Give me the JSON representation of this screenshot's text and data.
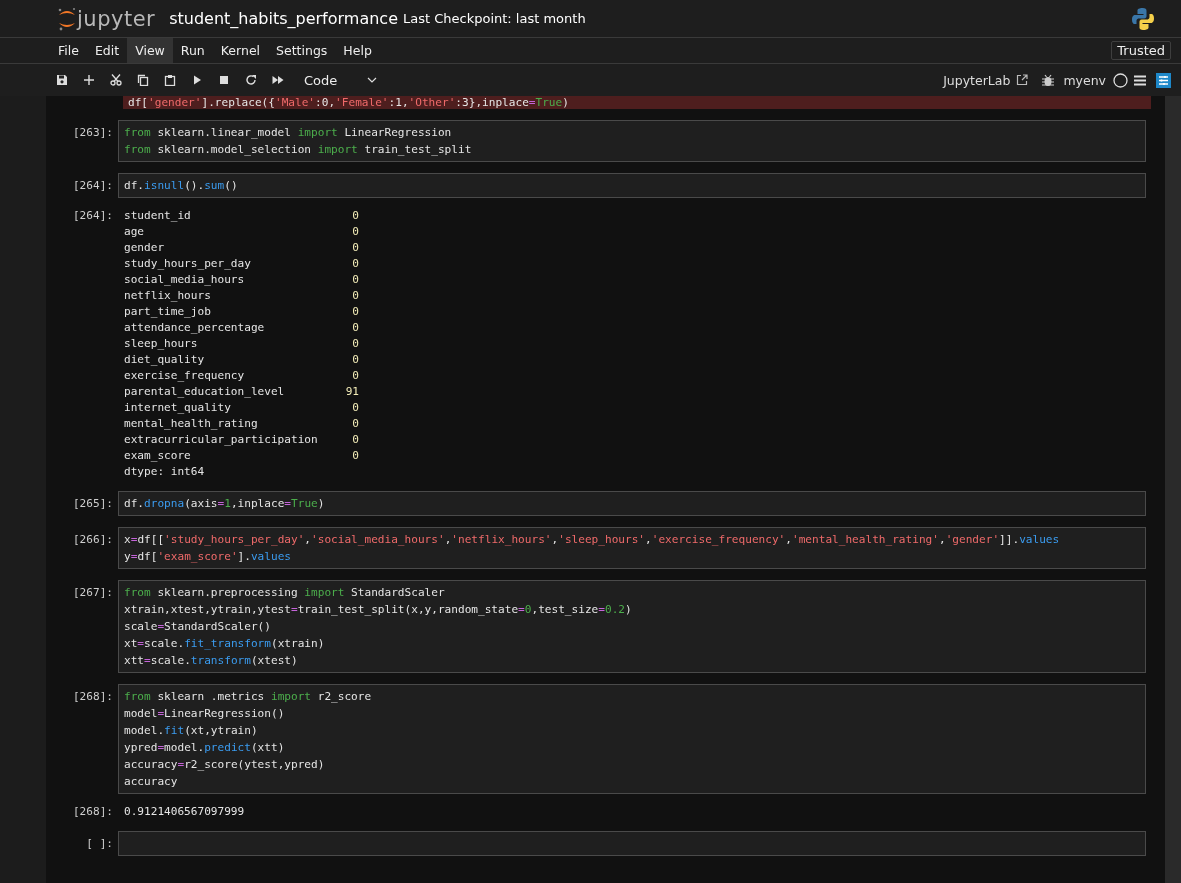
{
  "header": {
    "logo_text": "jupyter",
    "title": "student_habits_performance",
    "checkpoint": "Last Checkpoint: last month"
  },
  "menu": {
    "items": [
      {
        "label": "File",
        "selected": false
      },
      {
        "label": "Edit",
        "selected": false
      },
      {
        "label": "View",
        "selected": true
      },
      {
        "label": "Run",
        "selected": false
      },
      {
        "label": "Kernel",
        "selected": false
      },
      {
        "label": "Settings",
        "selected": false
      },
      {
        "label": "Help",
        "selected": false
      }
    ],
    "trusted": "Trusted"
  },
  "toolbar": {
    "cell_type": "Code",
    "jupyterlab": "JupyterLab",
    "kernel": "myenv"
  },
  "cells": [
    {
      "kind": "clipped",
      "lines": [
        [
          {
            "kind": "txt",
            "text": "df["
          },
          {
            "kind": "str",
            "text": "'gender'"
          },
          {
            "kind": "txt",
            "text": "].replace({"
          },
          {
            "kind": "str",
            "text": "'Male'"
          },
          {
            "kind": "txt",
            "text": ":0,"
          },
          {
            "kind": "str",
            "text": "'Female'"
          },
          {
            "kind": "txt",
            "text": ":1,"
          },
          {
            "kind": "str",
            "text": "'Other'"
          },
          {
            "kind": "txt",
            "text": ":3},inplace"
          },
          {
            "kind": "op",
            "text": "="
          },
          {
            "kind": "kw",
            "text": "True"
          },
          {
            "kind": "txt",
            "text": ")"
          }
        ]
      ]
    },
    {
      "kind": "code",
      "prompt": "[263]:",
      "lines": [
        [
          {
            "kind": "kw",
            "text": "from"
          },
          {
            "kind": "txt",
            "text": " sklearn.linear_model "
          },
          {
            "kind": "kw",
            "text": "import"
          },
          {
            "kind": "txt",
            "text": " LinearRegression"
          }
        ],
        [
          {
            "kind": "kw",
            "text": "from"
          },
          {
            "kind": "txt",
            "text": " sklearn.model_selection "
          },
          {
            "kind": "kw",
            "text": "import"
          },
          {
            "kind": "txt",
            "text": " train_test_split"
          }
        ]
      ]
    },
    {
      "kind": "code",
      "prompt": "[264]:",
      "lines": [
        [
          {
            "kind": "txt",
            "text": "df."
          },
          {
            "kind": "fn",
            "text": "isnull"
          },
          {
            "kind": "txt",
            "text": "()."
          },
          {
            "kind": "fn",
            "text": "sum"
          },
          {
            "kind": "txt",
            "text": "()"
          }
        ]
      ],
      "output": {
        "kind": "series",
        "prompt": "[264]:",
        "rows": [
          {
            "name": "student_id",
            "value": "0"
          },
          {
            "name": "age",
            "value": "0"
          },
          {
            "name": "gender",
            "value": "0"
          },
          {
            "name": "study_hours_per_day",
            "value": "0"
          },
          {
            "name": "social_media_hours",
            "value": "0"
          },
          {
            "name": "netflix_hours",
            "value": "0"
          },
          {
            "name": "part_time_job",
            "value": "0"
          },
          {
            "name": "attendance_percentage",
            "value": "0"
          },
          {
            "name": "sleep_hours",
            "value": "0"
          },
          {
            "name": "diet_quality",
            "value": "0"
          },
          {
            "name": "exercise_frequency",
            "value": "0"
          },
          {
            "name": "parental_education_level",
            "value": "91"
          },
          {
            "name": "internet_quality",
            "value": "0"
          },
          {
            "name": "mental_health_rating",
            "value": "0"
          },
          {
            "name": "extracurricular_participation",
            "value": "0"
          },
          {
            "name": "exam_score",
            "value": "0"
          }
        ],
        "dtype": "dtype: int64"
      }
    },
    {
      "kind": "code",
      "prompt": "[265]:",
      "lines": [
        [
          {
            "kind": "txt",
            "text": "df."
          },
          {
            "kind": "fn",
            "text": "dropna"
          },
          {
            "kind": "txt",
            "text": "(axis"
          },
          {
            "kind": "op",
            "text": "="
          },
          {
            "kind": "num",
            "text": "1"
          },
          {
            "kind": "txt",
            "text": ",inplace"
          },
          {
            "kind": "op",
            "text": "="
          },
          {
            "kind": "kw",
            "text": "True"
          },
          {
            "kind": "txt",
            "text": ")"
          }
        ]
      ]
    },
    {
      "kind": "code",
      "prompt": "[266]:",
      "lines": [
        [
          {
            "kind": "txt",
            "text": "x"
          },
          {
            "kind": "op",
            "text": "="
          },
          {
            "kind": "txt",
            "text": "df[["
          },
          {
            "kind": "str",
            "text": "'study_hours_per_day'"
          },
          {
            "kind": "txt",
            "text": ","
          },
          {
            "kind": "str",
            "text": "'social_media_hours'"
          },
          {
            "kind": "txt",
            "text": ","
          },
          {
            "kind": "str",
            "text": "'netflix_hours'"
          },
          {
            "kind": "txt",
            "text": ","
          },
          {
            "kind": "str",
            "text": "'sleep_hours'"
          },
          {
            "kind": "txt",
            "text": ","
          },
          {
            "kind": "str",
            "text": "'exercise_frequency'"
          },
          {
            "kind": "txt",
            "text": ","
          },
          {
            "kind": "str",
            "text": "'mental_health_rating'"
          },
          {
            "kind": "txt",
            "text": ","
          },
          {
            "kind": "str",
            "text": "'gender'"
          },
          {
            "kind": "txt",
            "text": "]]."
          },
          {
            "kind": "fn",
            "text": "values"
          }
        ],
        [
          {
            "kind": "txt",
            "text": "y"
          },
          {
            "kind": "op",
            "text": "="
          },
          {
            "kind": "txt",
            "text": "df["
          },
          {
            "kind": "str",
            "text": "'exam_score'"
          },
          {
            "kind": "txt",
            "text": "]."
          },
          {
            "kind": "fn",
            "text": "values"
          }
        ]
      ]
    },
    {
      "kind": "code",
      "prompt": "[267]:",
      "lines": [
        [
          {
            "kind": "kw",
            "text": "from"
          },
          {
            "kind": "txt",
            "text": " sklearn.preprocessing "
          },
          {
            "kind": "kw",
            "text": "import"
          },
          {
            "kind": "txt",
            "text": " StandardScaler"
          }
        ],
        [
          {
            "kind": "txt",
            "text": "xtrain,xtest,ytrain,ytest"
          },
          {
            "kind": "op",
            "text": "="
          },
          {
            "kind": "txt",
            "text": "train_test_split(x,y,random_state"
          },
          {
            "kind": "op",
            "text": "="
          },
          {
            "kind": "num",
            "text": "0"
          },
          {
            "kind": "txt",
            "text": ",test_size"
          },
          {
            "kind": "op",
            "text": "="
          },
          {
            "kind": "num",
            "text": "0.2"
          },
          {
            "kind": "txt",
            "text": ")"
          }
        ],
        [
          {
            "kind": "txt",
            "text": "scale"
          },
          {
            "kind": "op",
            "text": "="
          },
          {
            "kind": "txt",
            "text": "StandardScaler()"
          }
        ],
        [
          {
            "kind": "txt",
            "text": "xt"
          },
          {
            "kind": "op",
            "text": "="
          },
          {
            "kind": "txt",
            "text": "scale."
          },
          {
            "kind": "fn",
            "text": "fit_transform"
          },
          {
            "kind": "txt",
            "text": "(xtrain)"
          }
        ],
        [
          {
            "kind": "txt",
            "text": "xtt"
          },
          {
            "kind": "op",
            "text": "="
          },
          {
            "kind": "txt",
            "text": "scale."
          },
          {
            "kind": "fn",
            "text": "transform"
          },
          {
            "kind": "txt",
            "text": "(xtest)"
          }
        ]
      ]
    },
    {
      "kind": "code",
      "prompt": "[268]:",
      "lines": [
        [
          {
            "kind": "kw",
            "text": "from"
          },
          {
            "kind": "txt",
            "text": " sklearn .metrics "
          },
          {
            "kind": "kw",
            "text": "import"
          },
          {
            "kind": "txt",
            "text": " r2_score"
          }
        ],
        [
          {
            "kind": "txt",
            "text": "model"
          },
          {
            "kind": "op",
            "text": "="
          },
          {
            "kind": "txt",
            "text": "LinearRegression()"
          }
        ],
        [
          {
            "kind": "txt",
            "text": "model."
          },
          {
            "kind": "fn",
            "text": "fit"
          },
          {
            "kind": "txt",
            "text": "(xt,ytrain)"
          }
        ],
        [
          {
            "kind": "txt",
            "text": "ypred"
          },
          {
            "kind": "op",
            "text": "="
          },
          {
            "kind": "txt",
            "text": "model."
          },
          {
            "kind": "fn",
            "text": "predict"
          },
          {
            "kind": "txt",
            "text": "(xtt)"
          }
        ],
        [
          {
            "kind": "txt",
            "text": "accuracy"
          },
          {
            "kind": "op",
            "text": "="
          },
          {
            "kind": "txt",
            "text": "r2_score(ytest,ypred)"
          }
        ],
        [
          {
            "kind": "txt",
            "text": "accuracy"
          }
        ]
      ],
      "output": {
        "kind": "text",
        "prompt": "[268]:",
        "text": "0.9121406567097999"
      }
    },
    {
      "kind": "code",
      "prompt": "[ ]:"
    }
  ]
}
